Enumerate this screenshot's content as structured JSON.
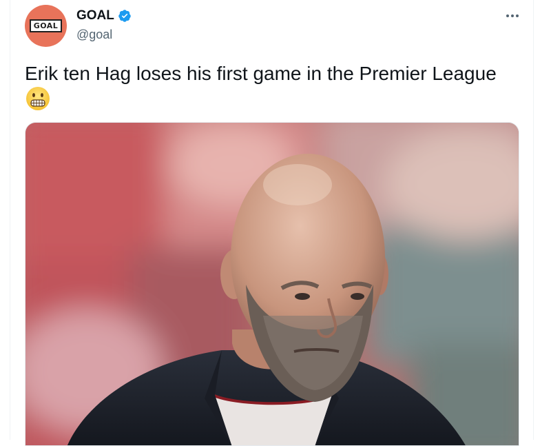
{
  "author": {
    "display_name": "GOAL",
    "handle": "@goal",
    "avatar_logo_text": "GOAL",
    "verified": true,
    "avatar_color": "#e8735a",
    "verified_color": "#1d9bf0"
  },
  "tweet": {
    "text": "Erik ten Hag loses his first game in the Premier League",
    "emoji": "grimacing-face"
  },
  "actions": {
    "more_icon": "more-horizontal-icon"
  },
  "media": {
    "type": "photo",
    "subject": "bald bearded man in dark jacket",
    "background_colors": [
      "#c9555a",
      "#e0a0a0",
      "#7a8a8a"
    ]
  }
}
